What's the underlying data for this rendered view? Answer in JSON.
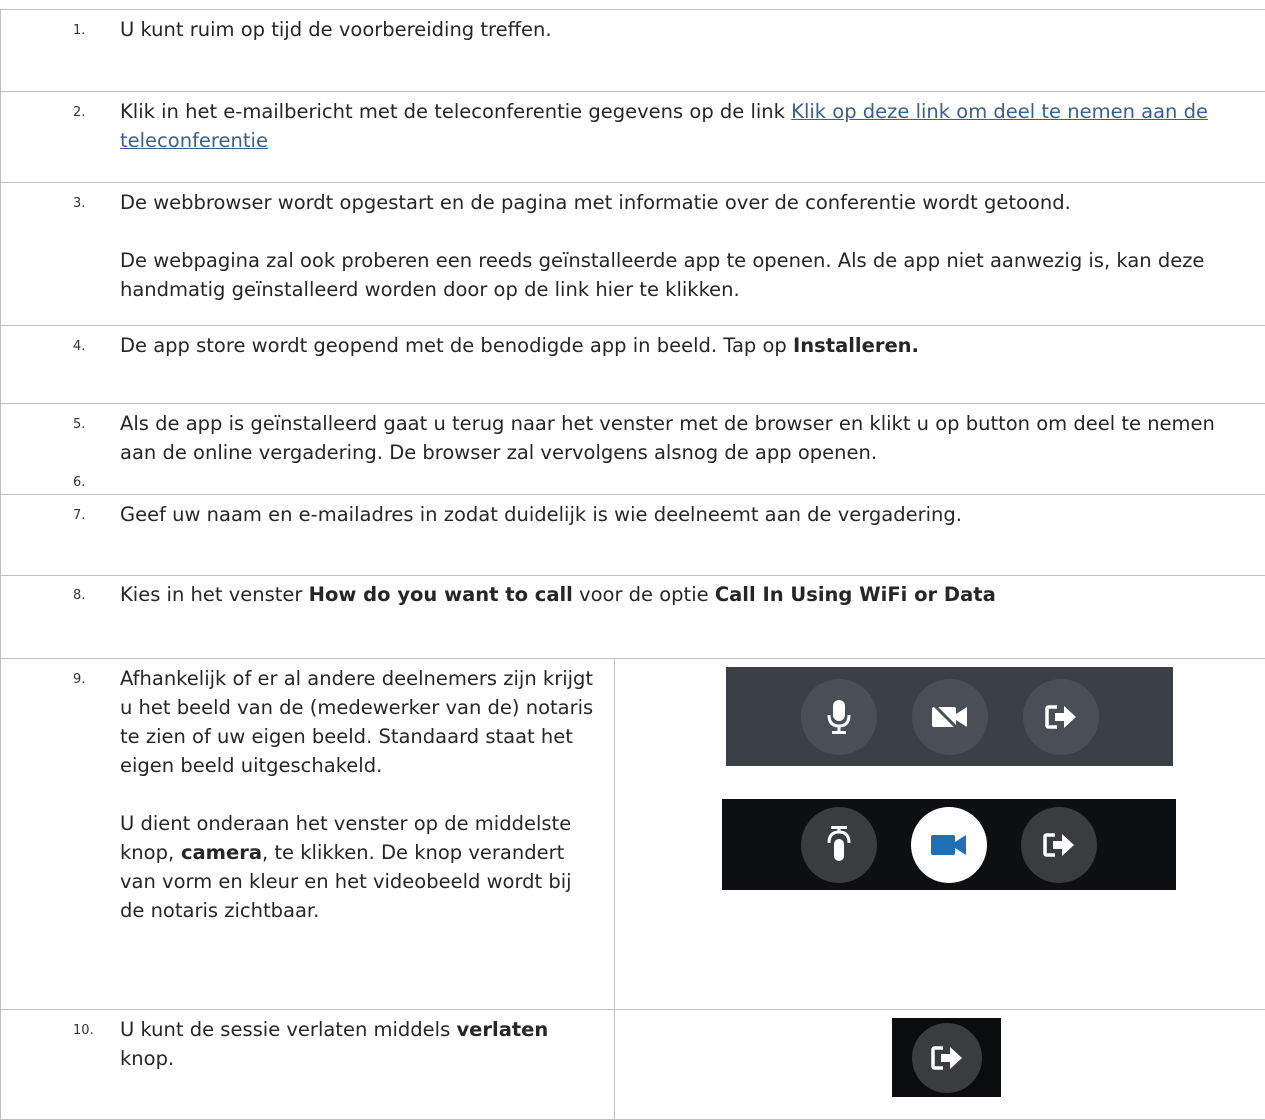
{
  "steps": [
    {
      "num": "1.",
      "text": "U kunt ruim op tijd de voorbereiding treffen."
    },
    {
      "num": "2.",
      "text_before": "Klik in het e-mailbericht met de teleconferentie gegevens op de link ",
      "link": "Klik op deze link om deel te nemen aan de teleconferentie"
    },
    {
      "num": "3.",
      "text": "De webbrowser wordt opgestart en de pagina met informatie over de conferentie wordt getoond.",
      "text2": "De webpagina zal ook proberen een reeds geïnstalleerde app te openen. Als de app niet aanwezig is, kan deze handmatig geïnstalleerd worden door op de link hier te klikken."
    },
    {
      "num": "4.",
      "text_before": "De app store wordt geopend met de benodigde app in beeld. Tap op ",
      "bold": "Installeren."
    },
    {
      "num": "5.",
      "text": "Als de app is geïnstalleerd gaat u terug naar het venster met de browser en klikt u op button om deel te nemen aan de online vergadering. De browser zal vervolgens alsnog de app openen.",
      "num2": "6."
    },
    {
      "num": "7.",
      "text": "Geef uw naam en e-mailadres in zodat duidelijk is wie deelneemt aan de vergadering."
    },
    {
      "num": "8.",
      "text_a": "Kies in het venster ",
      "bold_a": "How do you want to call",
      "text_b": " voor de optie ",
      "bold_b": "Call In Using WiFi or Data"
    },
    {
      "num": "9.",
      "text": "Afhankelijk of er al andere deelnemers zijn krijgt u het beeld van de (medewerker van de) notaris te zien of uw eigen beeld. Standaard staat het eigen beeld uitgeschakeld.",
      "text2_a": "U dient onderaan het venster op de middelste knop",
      "text2_comma1": ",",
      "text2_bold": " camera",
      "text2_b": ", te klikken. De knop verandert van vorm en kleur en het videobeeld wordt bij de notaris zichtbaar."
    },
    {
      "num": "10.",
      "text_a": "U kunt de sessie verlaten middels ",
      "bold": "verlaten",
      "text_b": " knop."
    }
  ],
  "icons": {
    "toolbar_top": [
      "microphone-icon",
      "camera-off-icon",
      "leave-icon"
    ],
    "toolbar_bottom": [
      "mic-muted-icon",
      "camera-on-icon",
      "leave-icon"
    ],
    "toolbar_single": [
      "leave-icon"
    ]
  },
  "colors": {
    "link": "#3b5f8a",
    "camera_active": "#1e6fb5",
    "toolbar_gray": "#3b3f47",
    "toolbar_black": "#0d0f10"
  }
}
